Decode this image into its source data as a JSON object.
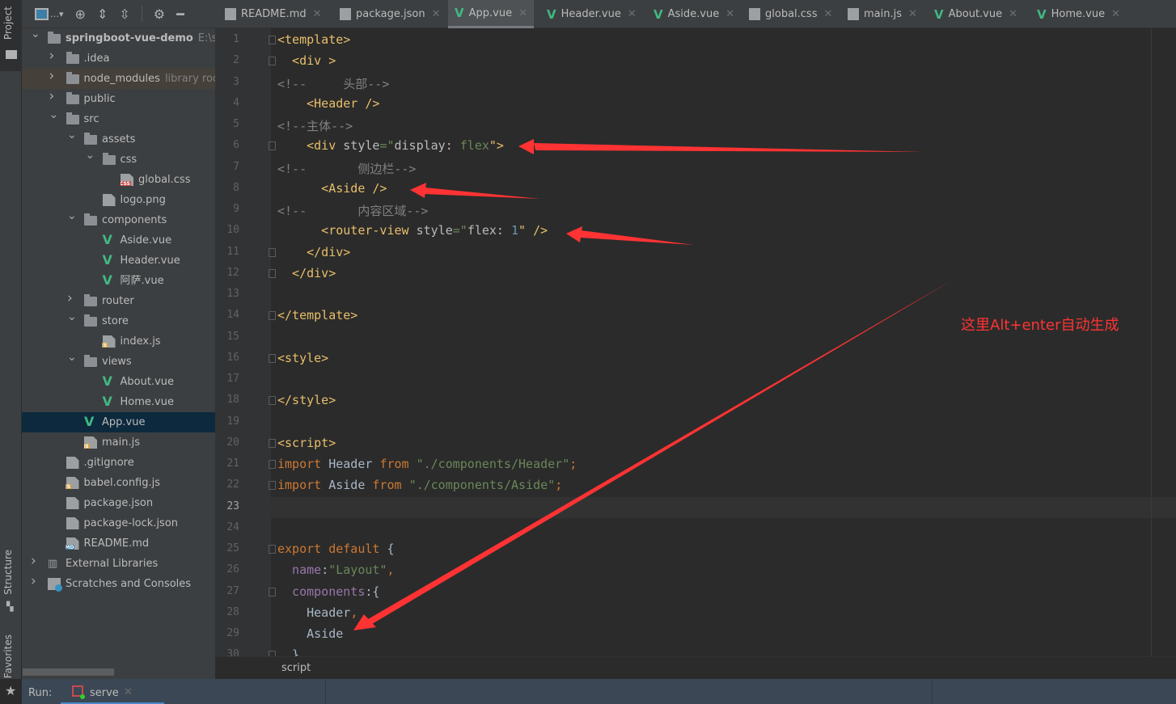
{
  "left_stripe": {
    "project": "Project",
    "structure": "Structure",
    "favorites": "Favorites"
  },
  "tabs": [
    {
      "label": "README.md",
      "icon": "md-file-icon"
    },
    {
      "label": "package.json",
      "icon": "json-file-icon"
    },
    {
      "label": "App.vue",
      "icon": "vue-file-icon",
      "active": true
    },
    {
      "label": "Header.vue",
      "icon": "vue-file-icon"
    },
    {
      "label": "Aside.vue",
      "icon": "vue-file-icon"
    },
    {
      "label": "global.css",
      "icon": "css-file-icon"
    },
    {
      "label": "main.js",
      "icon": "js-file-icon"
    },
    {
      "label": "About.vue",
      "icon": "vue-file-icon"
    },
    {
      "label": "Home.vue",
      "icon": "vue-file-icon"
    }
  ],
  "tree": [
    {
      "label": "springboot-vue-demo",
      "extra": "E:\\sp",
      "level": 0,
      "type": "project",
      "state": "open",
      "bold": true
    },
    {
      "label": ".idea",
      "level": 1,
      "type": "folder",
      "state": "closed"
    },
    {
      "label": "node_modules",
      "extra": "library root",
      "level": 1,
      "type": "folder",
      "state": "closed",
      "highlight": true
    },
    {
      "label": "public",
      "level": 1,
      "type": "folder",
      "state": "closed"
    },
    {
      "label": "src",
      "level": 1,
      "type": "folder",
      "state": "open"
    },
    {
      "label": "assets",
      "level": 2,
      "type": "folder",
      "state": "open"
    },
    {
      "label": "css",
      "level": 3,
      "type": "folder",
      "state": "open"
    },
    {
      "label": "global.css",
      "level": 4,
      "type": "css"
    },
    {
      "label": "logo.png",
      "level": 3,
      "type": "png"
    },
    {
      "label": "components",
      "level": 2,
      "type": "folder",
      "state": "open"
    },
    {
      "label": "Aside.vue",
      "level": 3,
      "type": "vue"
    },
    {
      "label": "Header.vue",
      "level": 3,
      "type": "vue"
    },
    {
      "label": "阿萨.vue",
      "level": 3,
      "type": "vue"
    },
    {
      "label": "router",
      "level": 2,
      "type": "folder",
      "state": "closed"
    },
    {
      "label": "store",
      "level": 2,
      "type": "folder",
      "state": "open"
    },
    {
      "label": "index.js",
      "level": 3,
      "type": "js"
    },
    {
      "label": "views",
      "level": 2,
      "type": "folder",
      "state": "open"
    },
    {
      "label": "About.vue",
      "level": 3,
      "type": "vue"
    },
    {
      "label": "Home.vue",
      "level": 3,
      "type": "vue"
    },
    {
      "label": "App.vue",
      "level": 2,
      "type": "vue",
      "selected": true
    },
    {
      "label": "main.js",
      "level": 2,
      "type": "js"
    },
    {
      "label": ".gitignore",
      "level": 1,
      "type": "file"
    },
    {
      "label": "babel.config.js",
      "level": 1,
      "type": "js"
    },
    {
      "label": "package.json",
      "level": 1,
      "type": "json"
    },
    {
      "label": "package-lock.json",
      "level": 1,
      "type": "json"
    },
    {
      "label": "README.md",
      "level": 1,
      "type": "md"
    },
    {
      "label": "External Libraries",
      "level": 0,
      "type": "libs",
      "state": "closed"
    },
    {
      "label": "Scratches and Consoles",
      "level": 0,
      "type": "scratch",
      "state": "closed"
    }
  ],
  "code": [
    [
      [
        "<template>",
        "t"
      ]
    ],
    [
      [
        "  <div >",
        "t"
      ]
    ],
    [
      [
        "<!--     头部-->",
        "c"
      ]
    ],
    [
      [
        "    <Header />",
        "t"
      ]
    ],
    [
      [
        "<!--主体-->",
        "c"
      ]
    ],
    [
      [
        "    <div ",
        "t"
      ],
      [
        "style",
        "a"
      ],
      [
        "=\"",
        "s"
      ],
      [
        "display: ",
        "a"
      ],
      [
        "flex",
        "s"
      ],
      [
        "\">",
        "t"
      ]
    ],
    [
      [
        "<!--       侧边栏-->",
        "c"
      ]
    ],
    [
      [
        "      <Aside />",
        "t"
      ]
    ],
    [
      [
        "<!--       内容区域-->",
        "c"
      ]
    ],
    [
      [
        "      <router-view ",
        "t"
      ],
      [
        "style",
        "a"
      ],
      [
        "=\"",
        "s"
      ],
      [
        "flex: ",
        "a"
      ],
      [
        "1",
        "n"
      ],
      [
        "\" />",
        "t"
      ]
    ],
    [
      [
        "    </div>",
        "t"
      ]
    ],
    [
      [
        "  </div>",
        "t"
      ]
    ],
    [],
    [
      [
        "</template>",
        "t"
      ]
    ],
    [],
    [
      [
        "<style>",
        "t"
      ]
    ],
    [],
    [
      [
        "</style>",
        "t"
      ]
    ],
    [],
    [
      [
        "<script>",
        "t"
      ]
    ],
    [
      [
        "import ",
        "k"
      ],
      [
        "Header ",
        "d"
      ],
      [
        "from ",
        "k"
      ],
      [
        "\"./components/Header\"",
        "s"
      ],
      [
        ";",
        "k"
      ]
    ],
    [
      [
        "import ",
        "k"
      ],
      [
        "Aside ",
        "d"
      ],
      [
        "from ",
        "k"
      ],
      [
        "\"./components/Aside\"",
        "s"
      ],
      [
        ";",
        "k"
      ]
    ],
    [],
    [],
    [
      [
        "export default ",
        "k"
      ],
      [
        "{",
        "d"
      ]
    ],
    [
      [
        "  name",
        "p"
      ],
      [
        ":",
        "d"
      ],
      [
        "\"Layout\"",
        "s"
      ],
      [
        ",",
        "k"
      ]
    ],
    [
      [
        "  components",
        "p"
      ],
      [
        ":{",
        "d"
      ]
    ],
    [
      [
        "    Header",
        "d"
      ],
      [
        ",",
        "k"
      ]
    ],
    [
      [
        "    Aside",
        "d"
      ]
    ],
    [
      [
        "  }",
        "d"
      ]
    ]
  ],
  "current_line": 23,
  "breadcrumb": "script",
  "run": {
    "label": "Run:",
    "tab": "serve"
  },
  "annotation": {
    "note": "这里Alt+enter自动生成",
    "color": "#ff3333"
  },
  "colors": {
    "accent": "#4a88c7",
    "vue": "#41b883",
    "selected": "#0d293e"
  }
}
